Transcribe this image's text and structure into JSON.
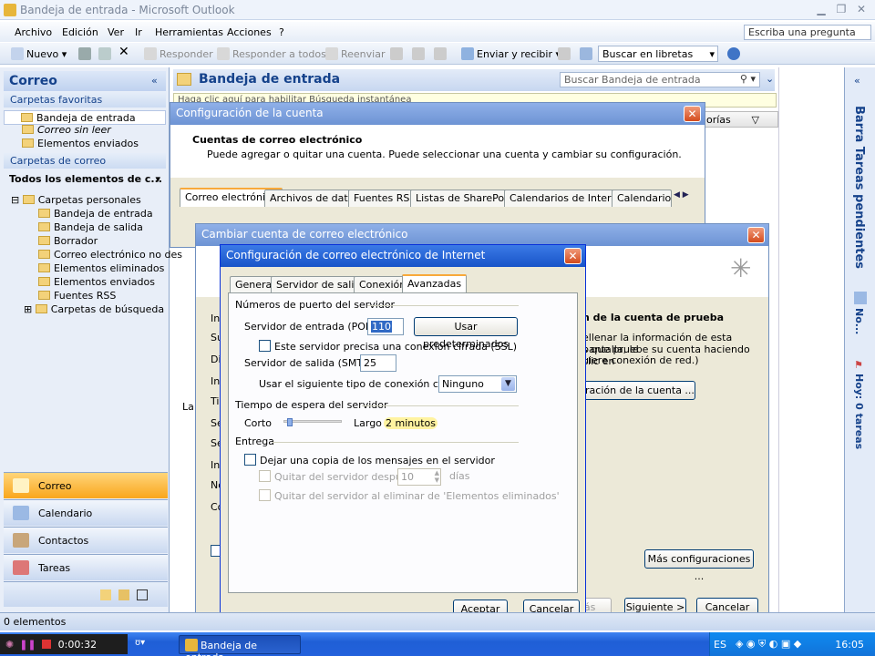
{
  "window": {
    "title": "Bandeja de entrada - Microsoft Outlook"
  },
  "menubar": {
    "items": [
      "Archivo",
      "Edición",
      "Ver",
      "Ir",
      "Herramientas",
      "Acciones",
      "?"
    ],
    "ask_placeholder": "Escriba una pregunta"
  },
  "toolbar": {
    "new": "Nuevo",
    "reply": "Responder",
    "reply_all": "Responder a todos",
    "forward": "Reenviar",
    "send_receive": "Enviar y recibir",
    "search_books": "Buscar en libretas"
  },
  "nav": {
    "title": "Correo",
    "favorites_header": "Carpetas favoritas",
    "favorites": [
      "Bandeja de entrada",
      "Correo sin leer",
      "Elementos enviados"
    ],
    "folders_header": "Carpetas de correo",
    "all_items": "Todos los elementos de c...",
    "personal": "Carpetas personales",
    "folders": [
      "Bandeja de entrada",
      "Bandeja de salida",
      "Borrador",
      "Correo electrónico no des",
      "Elementos eliminados",
      "Elementos enviados",
      "Fuentes RSS"
    ],
    "search_folders": "Carpetas de búsqueda",
    "buttons": [
      "Correo",
      "Calendario",
      "Contactos",
      "Tareas"
    ]
  },
  "main": {
    "title": "Bandeja de entrada",
    "search_placeholder": "Buscar Bandeja de entrada",
    "infobar": "Haga clic aquí para habilitar Búsqueda instantánea",
    "cat_header": "orías"
  },
  "rightbar": {
    "title": "Barra Tareas pendientes",
    "no": "No...",
    "tasks": "Hoy: 0 tareas"
  },
  "status": {
    "items": "0 elementos"
  },
  "dlg_account": {
    "title": "Configuración de la cuenta",
    "heading": "Cuentas de correo electrónico",
    "desc": "Puede agregar o quitar una cuenta. Puede seleccionar una cuenta y cambiar su configuración.",
    "tabs": [
      "Correo electrónico",
      "Archivos de datos",
      "Fuentes RSS",
      "Listas de SharePoint",
      "Calendarios de Internet",
      "Calendarios p"
    ]
  },
  "dlg_change": {
    "title": "Cambiar cuenta de correo electrónico",
    "test_heading": "n de la cuenta de prueba",
    "test_desc1": "ellenar la información de esta pantalla, le",
    "test_desc2": "s que pruebe su cuenta haciendo clic en",
    "test_desc3": "uiere conexión de red.)",
    "test_btn": "guración de la cuenta ...",
    "more_btn": "Más configuraciones ...",
    "back_btn": "Atrás",
    "next_btn": "Siguiente >",
    "cancel_btn": "Cancelar",
    "left_labels": [
      "Inf",
      "Su",
      "Di",
      "Inf",
      "Tip",
      "Se",
      "Se",
      "Inf",
      "No",
      "Co",
      "La"
    ]
  },
  "dlg_internet": {
    "title": "Configuración de correo electrónico de Internet",
    "tabs": [
      "General",
      "Servidor de salida",
      "Conexión",
      "Avanzadas"
    ],
    "ports_group": "Números de puerto del servidor",
    "incoming_label": "Servidor de entrada (POP3):",
    "incoming_value": "110",
    "defaults_btn": "Usar predeterminados",
    "ssl_label": "Este servidor precisa una conexión cifrada (SSL)",
    "outgoing_label": "Servidor de salida (SMTP):",
    "outgoing_value": "25",
    "encryption_label": "Usar el siguiente tipo de conexión cifrada:",
    "encryption_value": "Ninguno",
    "timeout_group": "Tiempo de espera del servidor",
    "short": "Corto",
    "long": "Largo",
    "timeout_value": "2 minutos",
    "timeout_level": 0.05,
    "delivery_group": "Entrega",
    "leave_copy": "Dejar una copia de los mensajes en el servidor",
    "remove_after": "Quitar del servidor después",
    "days_value": "10",
    "days": "días",
    "remove_deleted": "Quitar del servidor al eliminar de 'Elementos eliminados'",
    "ok_btn": "Aceptar",
    "cancel_btn": "Cancelar"
  },
  "taskbar": {
    "recorder_time": "0:00:32",
    "task": "Bandeja de entrada -...",
    "lang": "ES",
    "clock": "16:05"
  }
}
